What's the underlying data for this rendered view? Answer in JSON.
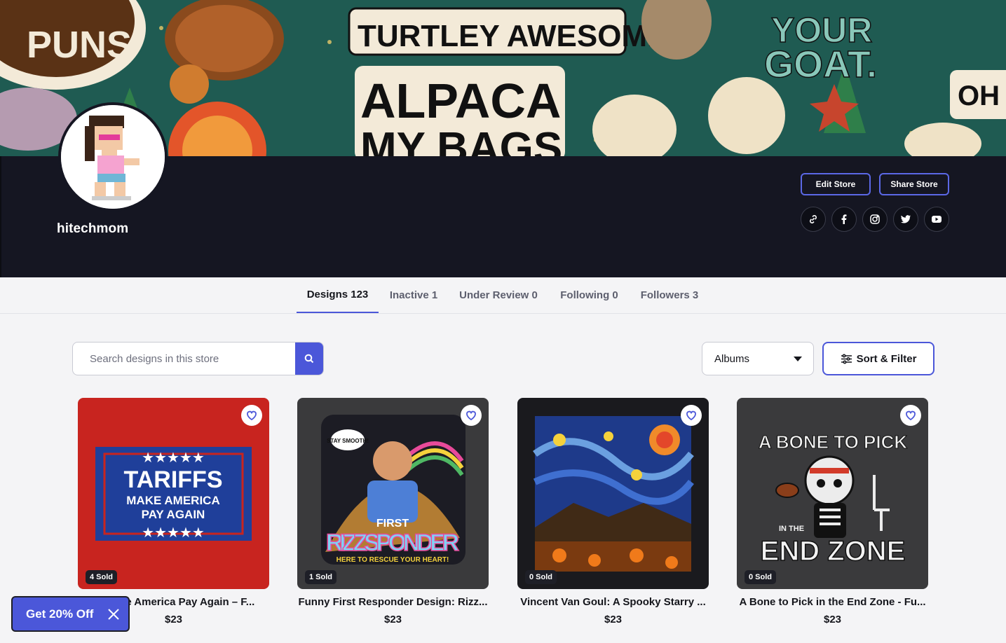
{
  "banner": {
    "texts": [
      "PUNS",
      "TURTLEY AWESOME",
      "ALPACA",
      "MY BAGS",
      "YOUR",
      "GOAT.",
      "OH"
    ]
  },
  "profile": {
    "username": "hitechmom",
    "edit_store_label": "Edit Store",
    "share_store_label": "Share Store",
    "social_icons": [
      "link-icon",
      "facebook-icon",
      "instagram-icon",
      "twitter-icon",
      "youtube-icon"
    ]
  },
  "tabs": [
    {
      "label": "Designs 123",
      "active": true
    },
    {
      "label": "Inactive 1",
      "active": false
    },
    {
      "label": "Under Review 0",
      "active": false
    },
    {
      "label": "Following 0",
      "active": false
    },
    {
      "label": "Followers 3",
      "active": false
    }
  ],
  "toolbar": {
    "search_placeholder": "Search designs in this store",
    "albums_label": "Albums",
    "sort_filter_label": "Sort & Filter"
  },
  "products": [
    {
      "title": "Make America Pay Again – F...",
      "visible_title": "ke America Pay Again – F...",
      "price": "$23",
      "sold": "4 Sold",
      "art": {
        "line1": "TARIFFS",
        "line2": "MAKE AMERICA",
        "line3": "PAY AGAIN"
      }
    },
    {
      "title": "Funny First Responder Design: Rizz...",
      "price": "$23",
      "sold": "1 Sold",
      "art": {
        "line1": "STAY SMOOTH!",
        "line2": "FIRST",
        "line3": "RIZZSPONDER",
        "line4": "HERE TO RESCUE YOUR HEART!"
      }
    },
    {
      "title": "Vincent Van Goul: A Spooky Starry ...",
      "price": "$23",
      "sold": "0 Sold"
    },
    {
      "title": "A Bone to Pick in the End Zone - Fu...",
      "price": "$23",
      "sold": "0 Sold",
      "art": {
        "line1": "A BONE TO PICK",
        "line2": "IN THE",
        "line3": "END ZONE"
      }
    }
  ],
  "promo": {
    "label": "Get 20% Off"
  },
  "colors": {
    "accent": "#4b57d9",
    "dark_band": "#151622"
  }
}
